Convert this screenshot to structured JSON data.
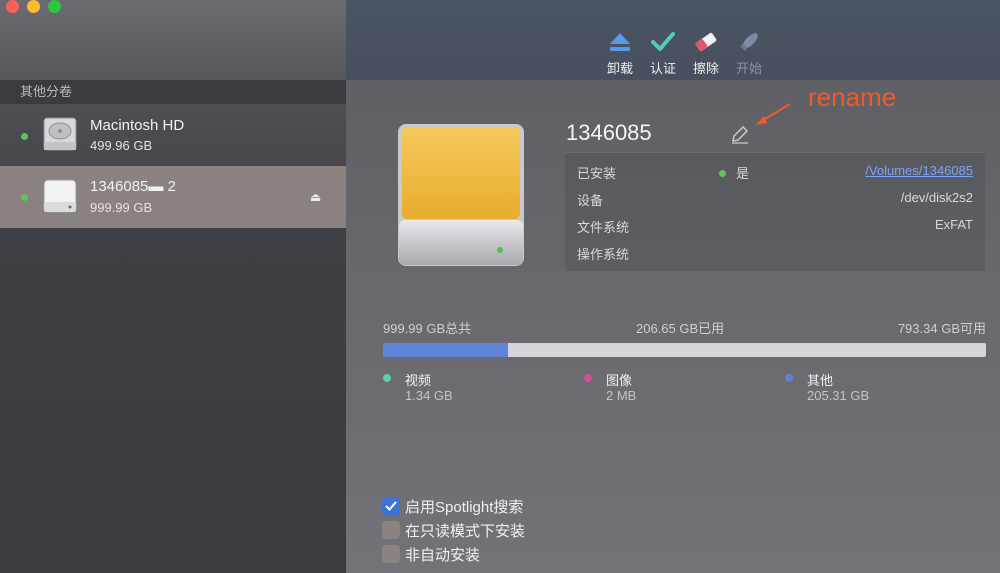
{
  "sidebar": {
    "section_title": "其他分卷",
    "disks": [
      {
        "name": "Macintosh HD",
        "size": "499.96 GB"
      },
      {
        "name": "1346085▬  2",
        "size": "999.99 GB"
      }
    ]
  },
  "toolbar": {
    "buttons": [
      {
        "label": "卸载",
        "icon": "eject-icon"
      },
      {
        "label": "认证",
        "icon": "checkmark-icon"
      },
      {
        "label": "擦除",
        "icon": "eraser-icon"
      },
      {
        "label": "开始",
        "icon": "rocket-icon"
      }
    ]
  },
  "volume": {
    "name": "1346085",
    "annotation": "rename"
  },
  "info": {
    "mounted_label": "已安装",
    "mounted_value": "是",
    "mounted_path": "/Volumes/1346085",
    "device_label": "设备",
    "device_value": "/dev/disk2s2",
    "fs_label": "文件系统",
    "fs_value": "ExFAT",
    "os_label": "操作系统"
  },
  "capacity": {
    "total": "999.99 GB总共",
    "used": "206.65 GB已用",
    "free": "793.34 GB可用",
    "used_fraction": 0.2067,
    "legend": [
      {
        "name": "视频",
        "size": "1.34 GB",
        "color": "#5fcfa3"
      },
      {
        "name": "图像",
        "size": "2 MB",
        "color": "#d64f9a"
      },
      {
        "name": "其他",
        "size": "205.31 GB",
        "color": "#5d84d6"
      }
    ]
  },
  "options": [
    {
      "label": "启用Spotlight搜索",
      "checked": true
    },
    {
      "label": "在只读模式下安装",
      "checked": false
    },
    {
      "label": "非自动安装",
      "checked": false
    }
  ],
  "colors": {
    "accent": "#3c74d6",
    "annotation": "#ef5a2a",
    "selection": "#8a8281"
  }
}
